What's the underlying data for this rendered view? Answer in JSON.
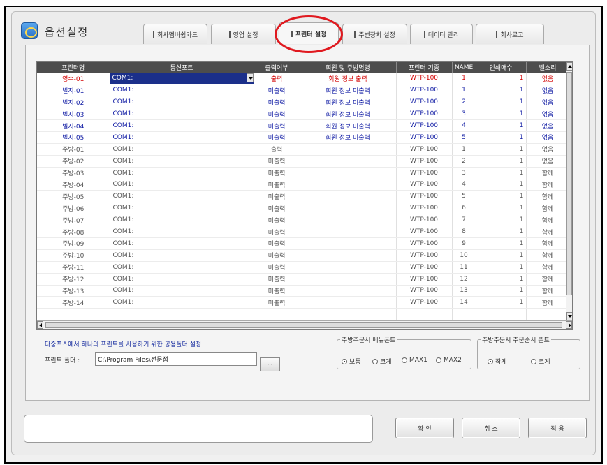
{
  "window": {
    "title": "옵션설정",
    "icon": "gear-icon"
  },
  "tabs": [
    {
      "label": "회사멤버쉽카드",
      "active": false
    },
    {
      "label": "영업 설정",
      "active": false
    },
    {
      "label": "프린터 설정",
      "active": true
    },
    {
      "label": "주변장치 설정",
      "active": false
    },
    {
      "label": "데이터 관리",
      "active": false
    },
    {
      "label": "회사로고",
      "active": false
    }
  ],
  "table": {
    "columns": [
      "프린터명",
      "통신포트",
      "출력여부",
      "회원 및 주방명령",
      "프린터 기종",
      "NAME",
      "인쇄매수",
      "벨소리"
    ],
    "rows": [
      {
        "name": "영수-01",
        "port": "COM1:",
        "output": "출력",
        "command": "회원 정보 출력",
        "model": "WTP-100",
        "nameval": "1",
        "copies": "1",
        "bell": "없음",
        "color": "red",
        "selected": true
      },
      {
        "name": "빌지-01",
        "port": "COM1:",
        "output": "미출력",
        "command": "회원 정보 미출력",
        "model": "WTP-100",
        "nameval": "1",
        "copies": "1",
        "bell": "없음",
        "color": "blue"
      },
      {
        "name": "빌지-02",
        "port": "COM1:",
        "output": "미출력",
        "command": "회원 정보 미출력",
        "model": "WTP-100",
        "nameval": "2",
        "copies": "1",
        "bell": "없음",
        "color": "blue"
      },
      {
        "name": "빌지-03",
        "port": "COM1:",
        "output": "미출력",
        "command": "회원 정보 미출력",
        "model": "WTP-100",
        "nameval": "3",
        "copies": "1",
        "bell": "없음",
        "color": "blue"
      },
      {
        "name": "빌지-04",
        "port": "COM1:",
        "output": "미출력",
        "command": "회원 정보 미출력",
        "model": "WTP-100",
        "nameval": "4",
        "copies": "1",
        "bell": "없음",
        "color": "blue"
      },
      {
        "name": "빌지-05",
        "port": "COM1:",
        "output": "미출력",
        "command": "회원 정보 미출력",
        "model": "WTP-100",
        "nameval": "5",
        "copies": "1",
        "bell": "없음",
        "color": "blue"
      },
      {
        "name": "주방-01",
        "port": "COM1:",
        "output": "출력",
        "command": "",
        "model": "WTP-100",
        "nameval": "1",
        "copies": "1",
        "bell": "없음",
        "color": "gray"
      },
      {
        "name": "주방-02",
        "port": "COM1:",
        "output": "미출력",
        "command": "",
        "model": "WTP-100",
        "nameval": "2",
        "copies": "1",
        "bell": "없음",
        "color": "gray"
      },
      {
        "name": "주방-03",
        "port": "COM1:",
        "output": "미출력",
        "command": "",
        "model": "WTP-100",
        "nameval": "3",
        "copies": "1",
        "bell": "함께",
        "color": "gray"
      },
      {
        "name": "주방-04",
        "port": "COM1:",
        "output": "미출력",
        "command": "",
        "model": "WTP-100",
        "nameval": "4",
        "copies": "1",
        "bell": "함께",
        "color": "gray"
      },
      {
        "name": "주방-05",
        "port": "COM1:",
        "output": "미출력",
        "command": "",
        "model": "WTP-100",
        "nameval": "5",
        "copies": "1",
        "bell": "함께",
        "color": "gray"
      },
      {
        "name": "주방-06",
        "port": "COM1:",
        "output": "미출력",
        "command": "",
        "model": "WTP-100",
        "nameval": "6",
        "copies": "1",
        "bell": "함께",
        "color": "gray"
      },
      {
        "name": "주방-07",
        "port": "COM1:",
        "output": "미출력",
        "command": "",
        "model": "WTP-100",
        "nameval": "7",
        "copies": "1",
        "bell": "함께",
        "color": "gray"
      },
      {
        "name": "주방-08",
        "port": "COM1:",
        "output": "미출력",
        "command": "",
        "model": "WTP-100",
        "nameval": "8",
        "copies": "1",
        "bell": "함께",
        "color": "gray"
      },
      {
        "name": "주방-09",
        "port": "COM1:",
        "output": "미출력",
        "command": "",
        "model": "WTP-100",
        "nameval": "9",
        "copies": "1",
        "bell": "함께",
        "color": "gray"
      },
      {
        "name": "주방-10",
        "port": "COM1:",
        "output": "미출력",
        "command": "",
        "model": "WTP-100",
        "nameval": "10",
        "copies": "1",
        "bell": "함께",
        "color": "gray"
      },
      {
        "name": "주방-11",
        "port": "COM1:",
        "output": "미출력",
        "command": "",
        "model": "WTP-100",
        "nameval": "11",
        "copies": "1",
        "bell": "함께",
        "color": "gray"
      },
      {
        "name": "주방-12",
        "port": "COM1:",
        "output": "미출력",
        "command": "",
        "model": "WTP-100",
        "nameval": "12",
        "copies": "1",
        "bell": "함께",
        "color": "gray"
      },
      {
        "name": "주방-13",
        "port": "COM1:",
        "output": "미출력",
        "command": "",
        "model": "WTP-100",
        "nameval": "13",
        "copies": "1",
        "bell": "함께",
        "color": "gray"
      },
      {
        "name": "주방-14",
        "port": "COM1:",
        "output": "미출력",
        "command": "",
        "model": "WTP-100",
        "nameval": "14",
        "copies": "1",
        "bell": "함께",
        "color": "gray"
      },
      {
        "name": "",
        "port": "",
        "output": "",
        "command": "",
        "model": "",
        "nameval": "",
        "copies": "",
        "bell": "",
        "color": "gray"
      }
    ]
  },
  "shared_folder": {
    "description": "다중포스에서 하나의 프린트를 사용하기 위한 공용폴더 설정",
    "label": "프린트 폴더 :",
    "value": "C:\\Program Files\\전문점",
    "browse_label": "..."
  },
  "kitchen_menu_font": {
    "legend": "주방주문서 메뉴폰트",
    "options": [
      {
        "label": "보통",
        "checked": true
      },
      {
        "label": "크게",
        "checked": false
      },
      {
        "label": "MAX1",
        "checked": false
      },
      {
        "label": "MAX2",
        "checked": false
      }
    ]
  },
  "kitchen_order_font": {
    "legend": "주방주문서 주문순서 폰트",
    "options": [
      {
        "label": "작게",
        "checked": true
      },
      {
        "label": "크게",
        "checked": false
      }
    ]
  },
  "buttons": {
    "confirm": "확 인",
    "cancel": "취 소",
    "apply": "적 용"
  },
  "colors": {
    "red": "#d20000",
    "blue": "#1520a6",
    "gray": "#555555",
    "header_bg": "#4d4d4d",
    "selection": "#1b2f8a",
    "annotation": "#e0191f"
  }
}
